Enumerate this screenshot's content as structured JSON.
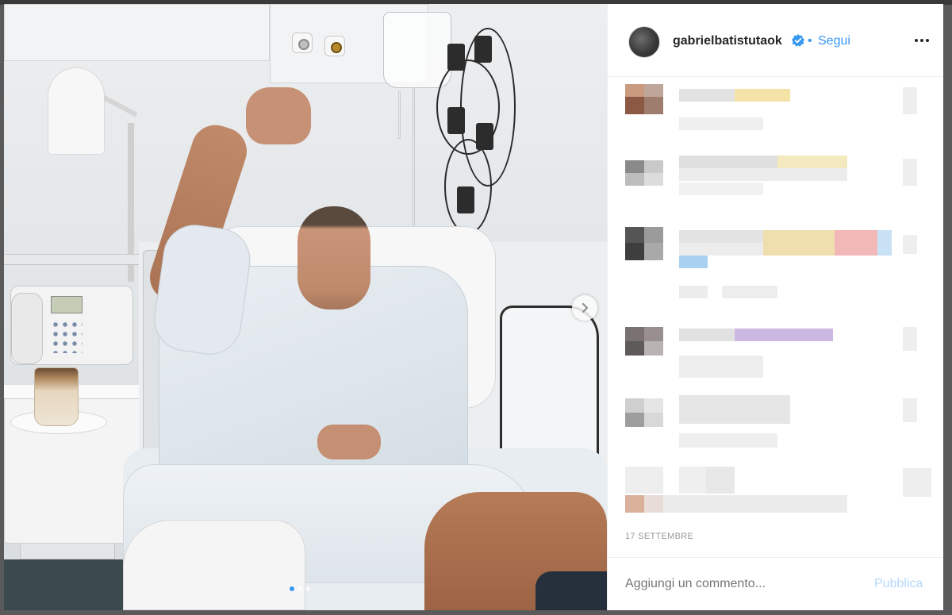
{
  "header": {
    "username": "gabrielbatistutaok",
    "separator": "•",
    "follow_label": "Segui"
  },
  "post": {
    "date": "17 SETTEMBRE"
  },
  "comment_box": {
    "placeholder": "Aggiungi un commento...",
    "publish_label": "Pubblica"
  },
  "colors": {
    "accent": "#3897f0",
    "publish_disabled": "#b2d8fb",
    "text_primary": "#262626",
    "text_muted": "#999999"
  },
  "icons": {
    "verified": "verified-badge-icon",
    "more": "more-options-icon",
    "next": "chevron-right-icon"
  },
  "carousel": {
    "count": 3,
    "active_index": 0
  }
}
